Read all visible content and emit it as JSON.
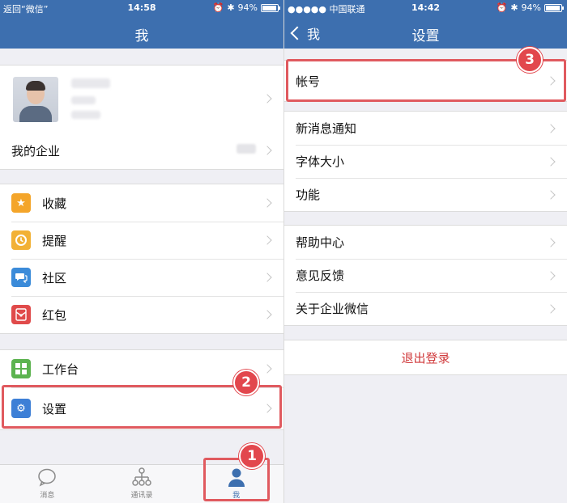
{
  "left": {
    "status": {
      "back_label": "返回“微信”",
      "time": "14:58",
      "battery": "94%",
      "battery_level": 0.94
    },
    "nav": {
      "title": "我"
    },
    "profile_row": {
      "chevron": "chevron-right-icon"
    },
    "enterprise": {
      "label": "我的企业"
    },
    "menu": [
      {
        "label": "收藏",
        "icon": "star-icon",
        "color": "#f4a52a"
      },
      {
        "label": "提醒",
        "icon": "clock-icon",
        "color": "#f2b136"
      },
      {
        "label": "社区",
        "icon": "chat-icon",
        "color": "#3b8bd9"
      },
      {
        "label": "红包",
        "icon": "red-packet-icon",
        "color": "#e04a4a"
      }
    ],
    "tools": [
      {
        "label": "工作台",
        "icon": "grid-icon",
        "color": "#5cb34f"
      },
      {
        "label": "设置",
        "icon": "gear-icon",
        "color": "#3d7fd6"
      }
    ],
    "tabs": [
      {
        "label": "消息",
        "icon": "message-bubble-icon"
      },
      {
        "label": "通讯录",
        "icon": "org-chart-icon"
      },
      {
        "label": "我",
        "icon": "person-icon"
      }
    ],
    "callouts": {
      "tab_me": "1",
      "settings": "2"
    }
  },
  "right": {
    "status": {
      "carrier": "●●●●● 中国联通",
      "time": "14:42",
      "battery": "94%",
      "battery_level": 0.94
    },
    "nav": {
      "back_label": "我",
      "title": "设置"
    },
    "account": [
      {
        "label": "帐号"
      }
    ],
    "group2": [
      {
        "label": "新消息通知"
      },
      {
        "label": "字体大小"
      },
      {
        "label": "功能"
      }
    ],
    "group3": [
      {
        "label": "帮助中心"
      },
      {
        "label": "意见反馈"
      },
      {
        "label": "关于企业微信"
      }
    ],
    "logout_label": "退出登录",
    "callouts": {
      "account": "3"
    }
  },
  "colors": {
    "nav_blue": "#3d6faf",
    "accent_red": "#e2474d",
    "logout_red": "#d0393b"
  }
}
